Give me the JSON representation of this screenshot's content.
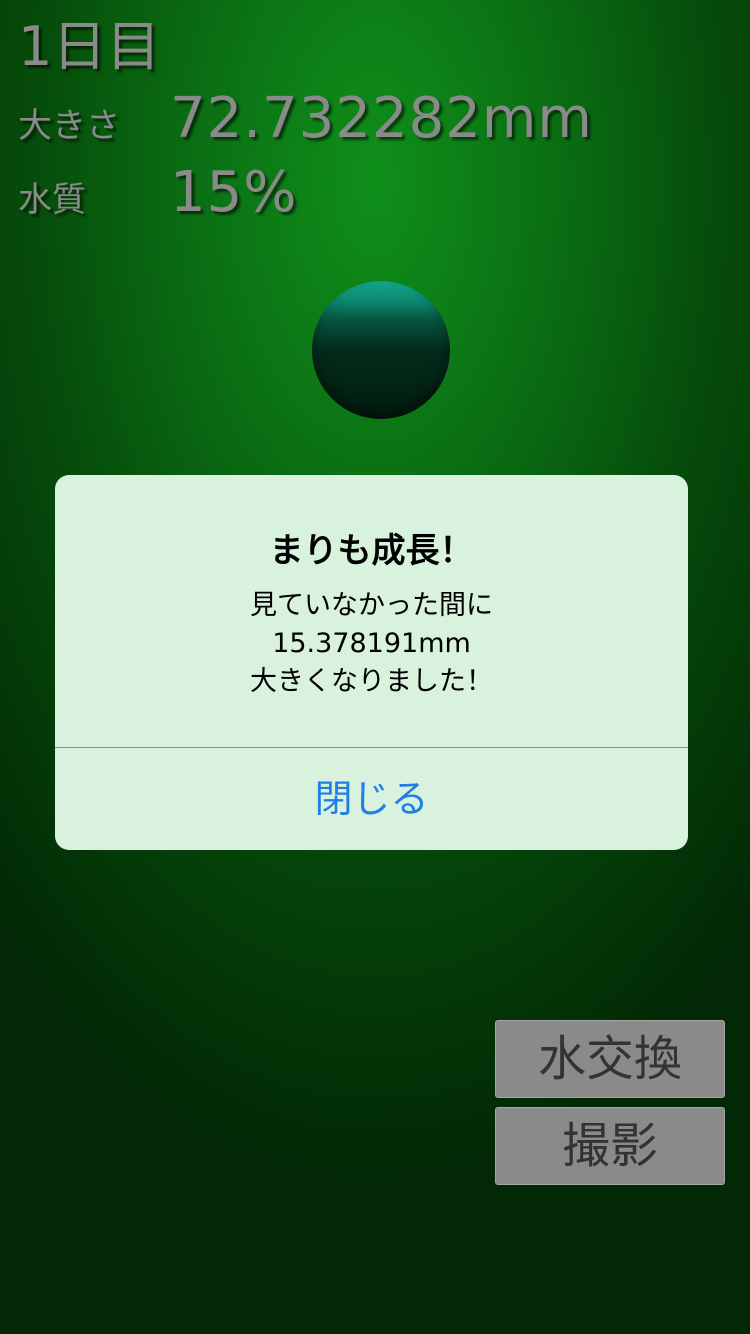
{
  "stats": {
    "day": "1日目",
    "size_label": "大きさ",
    "size_value": "72.732282mm",
    "water_label": "水質",
    "water_value": "15%"
  },
  "alert": {
    "title": "まりも成長！",
    "message_lines": [
      "見ていなかった間に",
      "15.378191mm",
      "大きくなりました！"
    ],
    "close_label": "閉じる"
  },
  "buttons": {
    "water_change": "水交換",
    "photo": "撮影"
  },
  "colors": {
    "background": "#0b7114",
    "alert_background": "#d9f2de",
    "alert_button": "#1f7fe6",
    "action_button": "#8a8a8a"
  }
}
